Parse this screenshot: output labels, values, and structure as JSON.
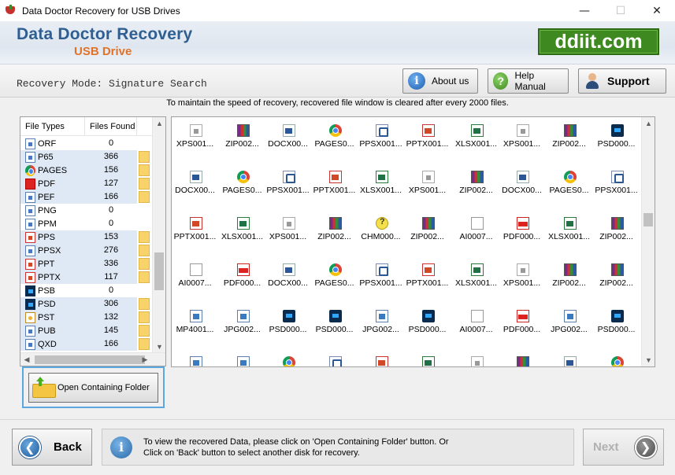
{
  "window": {
    "title": "Data Doctor Recovery for USB Drives",
    "minimize": "—",
    "maximize": "☐",
    "close": "✕"
  },
  "header": {
    "brand_line1": "Data Doctor Recovery",
    "brand_line2": "USB Drive",
    "logo_text": "ddiit.com"
  },
  "toolbar": {
    "mode_label": "Recovery Mode: Signature Search",
    "about_label": "About us",
    "help_label": "Help Manual",
    "support_label": "Support"
  },
  "notice": "To maintain the speed of recovery, recovered file window is cleared after every 2000 files.",
  "file_types": {
    "col_type": "File Types",
    "col_found": "Files Found",
    "rows": [
      {
        "name": "ORF",
        "count": "0",
        "icon": "doc",
        "found": false
      },
      {
        "name": "P65",
        "count": "366",
        "icon": "blank",
        "found": true
      },
      {
        "name": "PAGES",
        "count": "156",
        "icon": "chrome",
        "found": true
      },
      {
        "name": "PDF",
        "count": "127",
        "icon": "pdf",
        "found": true
      },
      {
        "name": "PEF",
        "count": "166",
        "icon": "doc",
        "found": true
      },
      {
        "name": "PNG",
        "count": "0",
        "icon": "doc",
        "found": false
      },
      {
        "name": "PPM",
        "count": "0",
        "icon": "blank",
        "found": false
      },
      {
        "name": "PPS",
        "count": "153",
        "icon": "pp",
        "found": true
      },
      {
        "name": "PPSX",
        "count": "276",
        "icon": "doc",
        "found": true
      },
      {
        "name": "PPT",
        "count": "336",
        "icon": "pp",
        "found": true
      },
      {
        "name": "PPTX",
        "count": "117",
        "icon": "pp",
        "found": true
      },
      {
        "name": "PSB",
        "count": "0",
        "icon": "ps",
        "found": false
      },
      {
        "name": "PSD",
        "count": "306",
        "icon": "ps",
        "found": true
      },
      {
        "name": "PST",
        "count": "132",
        "icon": "pst",
        "found": true
      },
      {
        "name": "PUB",
        "count": "145",
        "icon": "blank",
        "found": true
      },
      {
        "name": "QXD",
        "count": "166",
        "icon": "blank",
        "found": true
      }
    ]
  },
  "open_folder_label": "Open Containing Folder",
  "files": [
    [
      "XPS001...",
      "xps"
    ],
    [
      "ZIP002...",
      "zip"
    ],
    [
      "DOCX00...",
      "doc"
    ],
    [
      "PAGES0...",
      "chrome"
    ],
    [
      "PPSX001...",
      "ppsx"
    ],
    [
      "PPTX001...",
      "pptx"
    ],
    [
      "XLSX001...",
      "xlsx"
    ],
    [
      "XPS001...",
      "xps"
    ],
    [
      "ZIP002...",
      "zip"
    ],
    [
      "PSD000...",
      "psd"
    ],
    [
      "DOCX00...",
      "doc"
    ],
    [
      "PAGES0...",
      "chrome"
    ],
    [
      "PPSX001...",
      "ppsx"
    ],
    [
      "PPTX001...",
      "pptx"
    ],
    [
      "XLSX001...",
      "xlsx"
    ],
    [
      "XPS001...",
      "xps"
    ],
    [
      "ZIP002...",
      "zip"
    ],
    [
      "DOCX00...",
      "doc"
    ],
    [
      "PAGES0...",
      "chrome"
    ],
    [
      "PPSX001...",
      "ppsx"
    ],
    [
      "PPTX001...",
      "pptx"
    ],
    [
      "XLSX001...",
      "xlsx"
    ],
    [
      "XPS001...",
      "xps"
    ],
    [
      "ZIP002...",
      "zip"
    ],
    [
      "CHM000...",
      "chm"
    ],
    [
      "ZIP002...",
      "zip"
    ],
    [
      "AI0007...",
      "ai"
    ],
    [
      "PDF000...",
      "pdf"
    ],
    [
      "XLSX001...",
      "xlsx"
    ],
    [
      "ZIP002...",
      "zip"
    ],
    [
      "AI0007...",
      "ai"
    ],
    [
      "PDF000...",
      "pdf"
    ],
    [
      "DOCX00...",
      "doc"
    ],
    [
      "PAGES0...",
      "chrome"
    ],
    [
      "PPSX001...",
      "ppsx"
    ],
    [
      "PPTX001...",
      "pptx"
    ],
    [
      "XLSX001...",
      "xlsx"
    ],
    [
      "XPS001...",
      "xps"
    ],
    [
      "ZIP002...",
      "zip"
    ],
    [
      "ZIP002...",
      "zip"
    ],
    [
      "MP4001...",
      "mp4"
    ],
    [
      "JPG002...",
      "jpg"
    ],
    [
      "PSD000...",
      "psd"
    ],
    [
      "PSD000...",
      "psd"
    ],
    [
      "JPG002...",
      "jpg"
    ],
    [
      "PSD000...",
      "psd"
    ],
    [
      "AI0007...",
      "ai"
    ],
    [
      "PDF000...",
      "pdf"
    ],
    [
      "JPG002...",
      "jpg"
    ],
    [
      "PSD000...",
      "psd"
    ],
    [
      "",
      "jpg"
    ],
    [
      "",
      "jpg"
    ],
    [
      "",
      "chrome"
    ],
    [
      "",
      "ppsx"
    ],
    [
      "",
      "pptx"
    ],
    [
      "",
      "xlsx"
    ],
    [
      "",
      "xps"
    ],
    [
      "",
      "zip"
    ],
    [
      "",
      "doc"
    ],
    [
      "",
      "chrome"
    ]
  ],
  "bottom": {
    "back_label": "Back",
    "info_line1": "To view the recovered Data, please click on 'Open Containing Folder' button. Or",
    "info_line2": "Click on 'Back' button to select another disk for recovery.",
    "next_label": "Next"
  }
}
